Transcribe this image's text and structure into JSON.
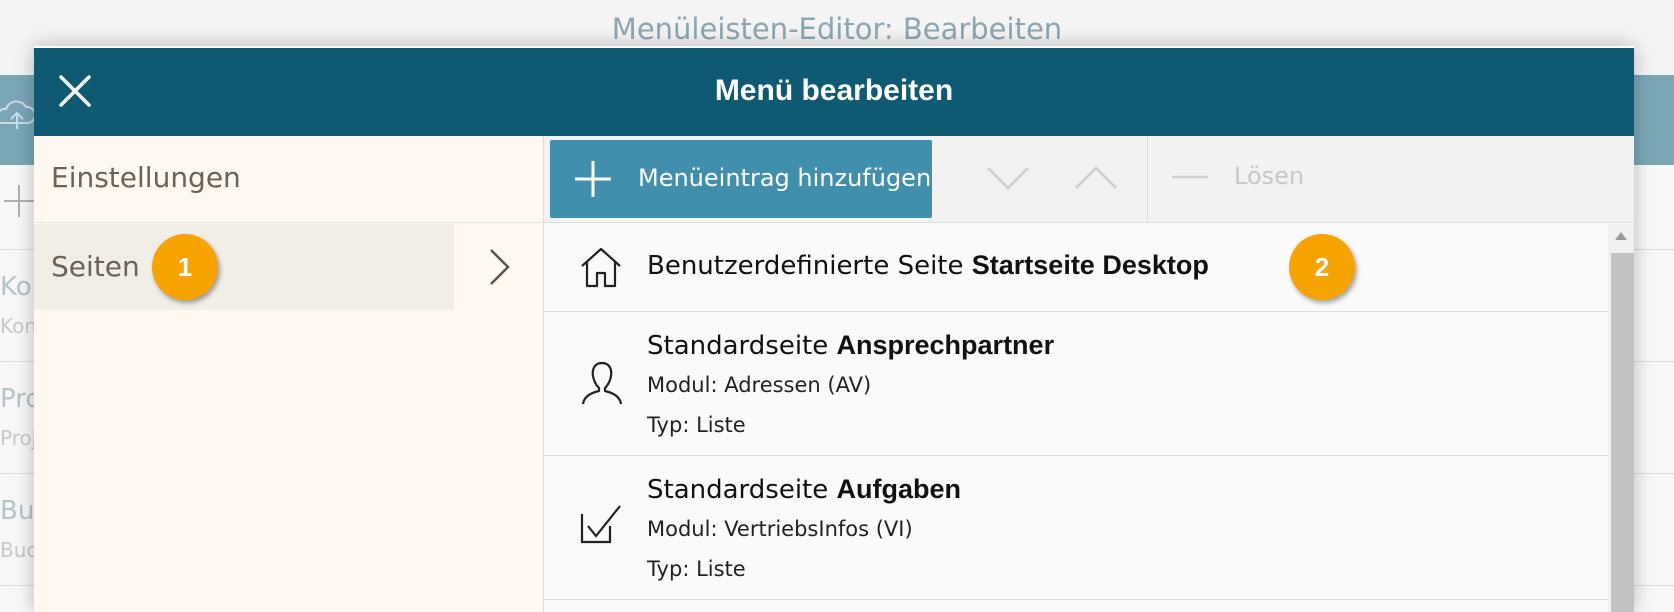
{
  "background": {
    "window_title": "Menüleisten-Editor: Bearbeiten",
    "rows": [
      {
        "line1": "Kon",
        "line2": "Kon"
      },
      {
        "line1": "Pro",
        "line2": "Proj"
      },
      {
        "line1": "Buc",
        "line2": "Buc"
      }
    ]
  },
  "dialog": {
    "title": "Menü bearbeiten"
  },
  "left_panel": {
    "settings_label": "Einstellungen",
    "pages_label": "Seiten",
    "pages_badge": "1"
  },
  "toolbar": {
    "add_label": "Menüeintrag hinzufügen",
    "detach_label": "Lösen"
  },
  "items": [
    {
      "title_prefix": "Benutzerdefinierte Seite ",
      "title_bold": "Startseite Desktop",
      "badge": "2",
      "icon": "home-icon"
    },
    {
      "title_prefix": "Standardseite ",
      "title_bold": "Ansprechpartner",
      "module": "Modul: Adressen (AV)",
      "type": "Typ: Liste",
      "icon": "person-icon"
    },
    {
      "title_prefix": "Standardseite ",
      "title_bold": "Aufgaben",
      "module": "Modul: VertriebsInfos (VI)",
      "type": "Typ: Liste",
      "icon": "checkbox-icon"
    }
  ],
  "colors": {
    "header": "#0e5a72",
    "accent_button": "#3f8fad",
    "badge": "#f7a400",
    "left_panel": "#fff8f1"
  }
}
